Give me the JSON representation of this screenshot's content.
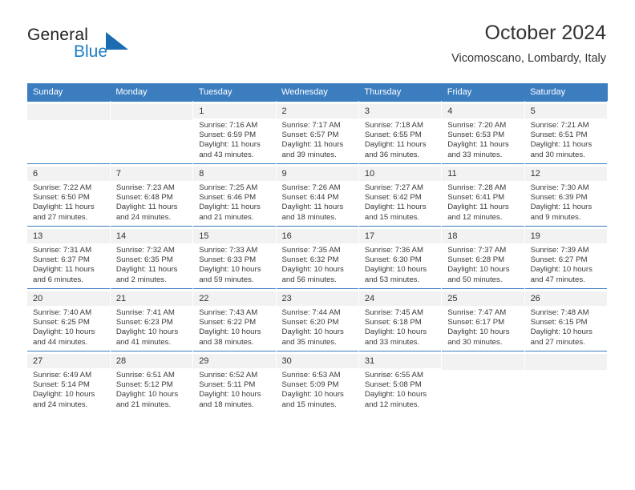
{
  "brand": {
    "name_part1": "General",
    "name_part2": "Blue",
    "triangle_color": "#1b6cb0",
    "blue_text_color": "#1a7dc4"
  },
  "header": {
    "title": "October 2024",
    "subtitle": "Vicomoscano, Lombardy, Italy"
  },
  "theme": {
    "header_row_bg": "#3c7dc0",
    "header_row_text": "#ffffff",
    "daynum_bg": "#f2f2f2",
    "cell_text": "#3a3a3a"
  },
  "weekdays": [
    "Sunday",
    "Monday",
    "Tuesday",
    "Wednesday",
    "Thursday",
    "Friday",
    "Saturday"
  ],
  "labels": {
    "sunrise_prefix": "Sunrise: ",
    "sunset_prefix": "Sunset: ",
    "daylight_prefix": "Daylight: "
  },
  "weeks": [
    [
      {
        "day": "",
        "sunrise": "",
        "sunset": "",
        "daylight": ""
      },
      {
        "day": "",
        "sunrise": "",
        "sunset": "",
        "daylight": ""
      },
      {
        "day": "1",
        "sunrise": "Sunrise: 7:16 AM",
        "sunset": "Sunset: 6:59 PM",
        "daylight": "Daylight: 11 hours and 43 minutes."
      },
      {
        "day": "2",
        "sunrise": "Sunrise: 7:17 AM",
        "sunset": "Sunset: 6:57 PM",
        "daylight": "Daylight: 11 hours and 39 minutes."
      },
      {
        "day": "3",
        "sunrise": "Sunrise: 7:18 AM",
        "sunset": "Sunset: 6:55 PM",
        "daylight": "Daylight: 11 hours and 36 minutes."
      },
      {
        "day": "4",
        "sunrise": "Sunrise: 7:20 AM",
        "sunset": "Sunset: 6:53 PM",
        "daylight": "Daylight: 11 hours and 33 minutes."
      },
      {
        "day": "5",
        "sunrise": "Sunrise: 7:21 AM",
        "sunset": "Sunset: 6:51 PM",
        "daylight": "Daylight: 11 hours and 30 minutes."
      }
    ],
    [
      {
        "day": "6",
        "sunrise": "Sunrise: 7:22 AM",
        "sunset": "Sunset: 6:50 PM",
        "daylight": "Daylight: 11 hours and 27 minutes."
      },
      {
        "day": "7",
        "sunrise": "Sunrise: 7:23 AM",
        "sunset": "Sunset: 6:48 PM",
        "daylight": "Daylight: 11 hours and 24 minutes."
      },
      {
        "day": "8",
        "sunrise": "Sunrise: 7:25 AM",
        "sunset": "Sunset: 6:46 PM",
        "daylight": "Daylight: 11 hours and 21 minutes."
      },
      {
        "day": "9",
        "sunrise": "Sunrise: 7:26 AM",
        "sunset": "Sunset: 6:44 PM",
        "daylight": "Daylight: 11 hours and 18 minutes."
      },
      {
        "day": "10",
        "sunrise": "Sunrise: 7:27 AM",
        "sunset": "Sunset: 6:42 PM",
        "daylight": "Daylight: 11 hours and 15 minutes."
      },
      {
        "day": "11",
        "sunrise": "Sunrise: 7:28 AM",
        "sunset": "Sunset: 6:41 PM",
        "daylight": "Daylight: 11 hours and 12 minutes."
      },
      {
        "day": "12",
        "sunrise": "Sunrise: 7:30 AM",
        "sunset": "Sunset: 6:39 PM",
        "daylight": "Daylight: 11 hours and 9 minutes."
      }
    ],
    [
      {
        "day": "13",
        "sunrise": "Sunrise: 7:31 AM",
        "sunset": "Sunset: 6:37 PM",
        "daylight": "Daylight: 11 hours and 6 minutes."
      },
      {
        "day": "14",
        "sunrise": "Sunrise: 7:32 AM",
        "sunset": "Sunset: 6:35 PM",
        "daylight": "Daylight: 11 hours and 2 minutes."
      },
      {
        "day": "15",
        "sunrise": "Sunrise: 7:33 AM",
        "sunset": "Sunset: 6:33 PM",
        "daylight": "Daylight: 10 hours and 59 minutes."
      },
      {
        "day": "16",
        "sunrise": "Sunrise: 7:35 AM",
        "sunset": "Sunset: 6:32 PM",
        "daylight": "Daylight: 10 hours and 56 minutes."
      },
      {
        "day": "17",
        "sunrise": "Sunrise: 7:36 AM",
        "sunset": "Sunset: 6:30 PM",
        "daylight": "Daylight: 10 hours and 53 minutes."
      },
      {
        "day": "18",
        "sunrise": "Sunrise: 7:37 AM",
        "sunset": "Sunset: 6:28 PM",
        "daylight": "Daylight: 10 hours and 50 minutes."
      },
      {
        "day": "19",
        "sunrise": "Sunrise: 7:39 AM",
        "sunset": "Sunset: 6:27 PM",
        "daylight": "Daylight: 10 hours and 47 minutes."
      }
    ],
    [
      {
        "day": "20",
        "sunrise": "Sunrise: 7:40 AM",
        "sunset": "Sunset: 6:25 PM",
        "daylight": "Daylight: 10 hours and 44 minutes."
      },
      {
        "day": "21",
        "sunrise": "Sunrise: 7:41 AM",
        "sunset": "Sunset: 6:23 PM",
        "daylight": "Daylight: 10 hours and 41 minutes."
      },
      {
        "day": "22",
        "sunrise": "Sunrise: 7:43 AM",
        "sunset": "Sunset: 6:22 PM",
        "daylight": "Daylight: 10 hours and 38 minutes."
      },
      {
        "day": "23",
        "sunrise": "Sunrise: 7:44 AM",
        "sunset": "Sunset: 6:20 PM",
        "daylight": "Daylight: 10 hours and 35 minutes."
      },
      {
        "day": "24",
        "sunrise": "Sunrise: 7:45 AM",
        "sunset": "Sunset: 6:18 PM",
        "daylight": "Daylight: 10 hours and 33 minutes."
      },
      {
        "day": "25",
        "sunrise": "Sunrise: 7:47 AM",
        "sunset": "Sunset: 6:17 PM",
        "daylight": "Daylight: 10 hours and 30 minutes."
      },
      {
        "day": "26",
        "sunrise": "Sunrise: 7:48 AM",
        "sunset": "Sunset: 6:15 PM",
        "daylight": "Daylight: 10 hours and 27 minutes."
      }
    ],
    [
      {
        "day": "27",
        "sunrise": "Sunrise: 6:49 AM",
        "sunset": "Sunset: 5:14 PM",
        "daylight": "Daylight: 10 hours and 24 minutes."
      },
      {
        "day": "28",
        "sunrise": "Sunrise: 6:51 AM",
        "sunset": "Sunset: 5:12 PM",
        "daylight": "Daylight: 10 hours and 21 minutes."
      },
      {
        "day": "29",
        "sunrise": "Sunrise: 6:52 AM",
        "sunset": "Sunset: 5:11 PM",
        "daylight": "Daylight: 10 hours and 18 minutes."
      },
      {
        "day": "30",
        "sunrise": "Sunrise: 6:53 AM",
        "sunset": "Sunset: 5:09 PM",
        "daylight": "Daylight: 10 hours and 15 minutes."
      },
      {
        "day": "31",
        "sunrise": "Sunrise: 6:55 AM",
        "sunset": "Sunset: 5:08 PM",
        "daylight": "Daylight: 10 hours and 12 minutes."
      },
      {
        "day": "",
        "sunrise": "",
        "sunset": "",
        "daylight": ""
      },
      {
        "day": "",
        "sunrise": "",
        "sunset": "",
        "daylight": ""
      }
    ]
  ]
}
